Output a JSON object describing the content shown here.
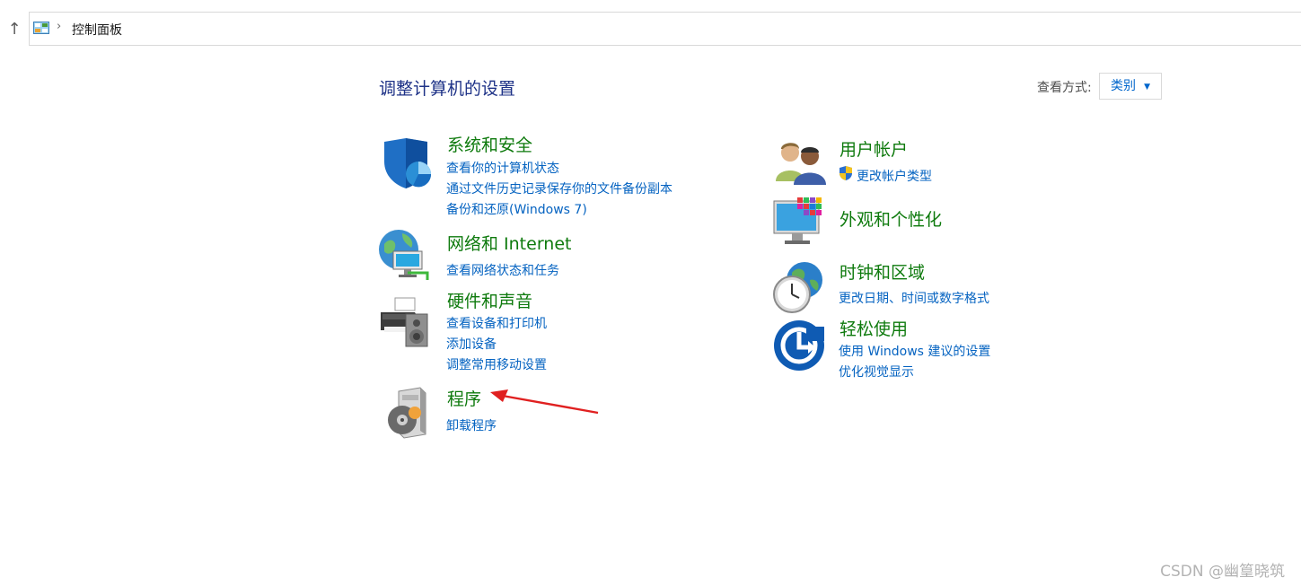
{
  "address_bar": {
    "up_icon": "arrow-up-icon",
    "location_icon": "control-panel-icon",
    "separator": "›",
    "crumb": "控制面板"
  },
  "header": {
    "title": "调整计算机的设置",
    "view_label": "查看方式:",
    "view_value": "类别"
  },
  "categories": {
    "system": {
      "title": "系统和安全",
      "icon": "shield-icon",
      "links": [
        "查看你的计算机状态",
        "通过文件历史记录保存你的文件备份副本",
        "备份和还原(Windows 7)"
      ]
    },
    "network": {
      "title": "网络和 Internet",
      "icon": "network-globe-icon",
      "links": [
        "查看网络状态和任务"
      ]
    },
    "hardware": {
      "title": "硬件和声音",
      "icon": "printer-speaker-icon",
      "links": [
        "查看设备和打印机",
        "添加设备",
        "调整常用移动设置"
      ]
    },
    "programs": {
      "title": "程序",
      "icon": "programs-disc-icon",
      "links": [
        "卸载程序"
      ]
    },
    "users": {
      "title": "用户帐户",
      "icon": "users-icon",
      "links": [
        "更改帐户类型"
      ]
    },
    "appearance": {
      "title": "外观和个性化",
      "icon": "monitor-palette-icon",
      "links": []
    },
    "clock": {
      "title": "时钟和区域",
      "icon": "clock-globe-icon",
      "links": [
        "更改日期、时间或数字格式"
      ]
    },
    "ease": {
      "title": "轻松使用",
      "icon": "ease-of-access-icon",
      "links": [
        "使用 Windows 建议的设置",
        "优化视觉显示"
      ]
    }
  },
  "colors": {
    "category_title": "#0e7a0d",
    "link": "#0563c1",
    "page_title": "#1e3287",
    "annotation_arrow": "#e02020"
  },
  "watermark": "CSDN @幽篁晓筑"
}
